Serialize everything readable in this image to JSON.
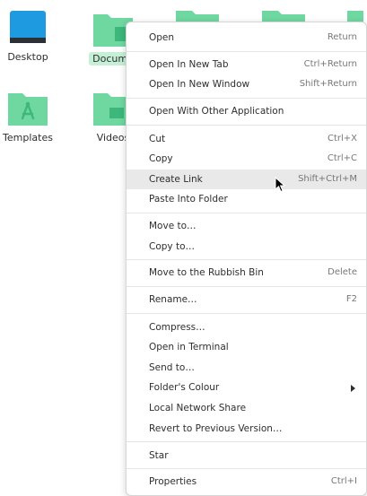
{
  "desktop": {
    "icons": [
      {
        "label": "Desktop"
      },
      {
        "label": "Docume"
      },
      {
        "label": "Templates"
      },
      {
        "label": "Videos"
      }
    ]
  },
  "colors": {
    "folder": "#6fd7a0",
    "folder_dark": "#3db77a",
    "folder_tab": "#5cc98f",
    "desktop_blue": "#1e9be0",
    "hover": "#e9e9e9"
  },
  "menu": {
    "open": {
      "label": "Open",
      "accel": "Return"
    },
    "open_new_tab": {
      "label": "Open In New Tab",
      "accel": "Ctrl+Return"
    },
    "open_new_window": {
      "label": "Open In New Window",
      "accel": "Shift+Return"
    },
    "open_other_app": {
      "label": "Open With Other Application"
    },
    "cut": {
      "label": "Cut",
      "accel": "Ctrl+X"
    },
    "copy": {
      "label": "Copy",
      "accel": "Ctrl+C"
    },
    "create_link": {
      "label": "Create Link",
      "accel": "Shift+Ctrl+M"
    },
    "paste_into_folder": {
      "label": "Paste Into Folder"
    },
    "move_to": {
      "label": "Move to…"
    },
    "copy_to": {
      "label": "Copy to…"
    },
    "move_to_rubbish": {
      "label": "Move to the Rubbish Bin",
      "accel": "Delete"
    },
    "rename": {
      "label": "Rename…",
      "accel": "F2"
    },
    "compress": {
      "label": "Compress…"
    },
    "open_terminal": {
      "label": "Open in Terminal"
    },
    "send_to": {
      "label": "Send to…"
    },
    "folder_colour": {
      "label": "Folder's Colour"
    },
    "local_network_share": {
      "label": "Local Network Share"
    },
    "revert_version": {
      "label": "Revert to Previous Version…"
    },
    "star": {
      "label": "Star"
    },
    "properties": {
      "label": "Properties",
      "accel": "Ctrl+I"
    }
  }
}
